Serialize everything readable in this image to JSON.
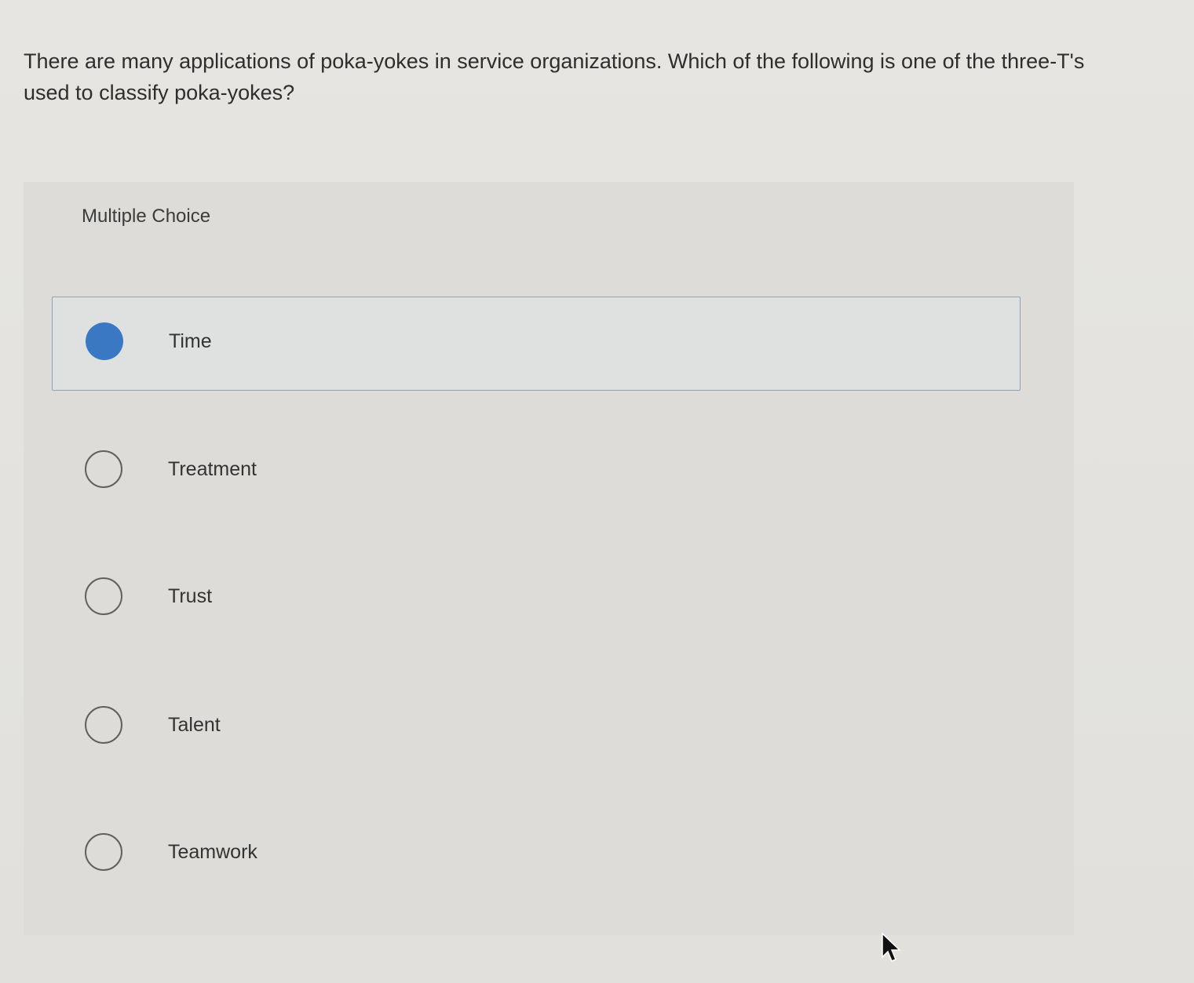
{
  "question": {
    "text": "There are many applications of poka-yokes in service organizations. Which of the following is one of the three-T's used to classify poka-yokes?"
  },
  "multiple_choice": {
    "label": "Multiple Choice",
    "options": [
      {
        "label": "Time",
        "selected": true
      },
      {
        "label": "Treatment",
        "selected": false
      },
      {
        "label": "Trust",
        "selected": false
      },
      {
        "label": "Talent",
        "selected": false
      },
      {
        "label": "Teamwork",
        "selected": false
      }
    ]
  },
  "colors": {
    "selected_radio": "#3a78c4",
    "selected_border": "#8fa3b6"
  },
  "icons": {
    "cursor": "mouse-pointer-icon"
  }
}
